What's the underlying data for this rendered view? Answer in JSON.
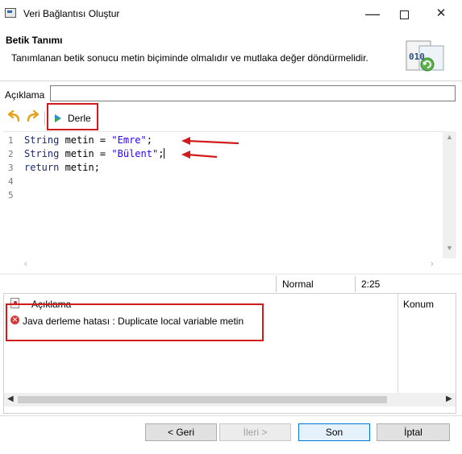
{
  "window": {
    "title": "Veri Bağlantısı Oluştur",
    "minimize_glyph": "—",
    "close_glyph": "✕"
  },
  "header": {
    "title": "Betik Tanımı",
    "description": "Tanımlanan betik sonucu metin biçiminde olmalıdır ve mutlaka değer döndürmelidir.",
    "icon_text": "010"
  },
  "form": {
    "description_label": "Açıklama",
    "description_value": ""
  },
  "toolbar": {
    "undo_icon": "undo-icon",
    "redo_icon": "redo-icon",
    "compile_label": "Derle"
  },
  "editor": {
    "line_numbers": [
      "1",
      "2",
      "3",
      "4",
      "5"
    ],
    "lines": [
      {
        "kw": "String",
        "rest": " metin = ",
        "str": "\"Emre\"",
        "end": ";"
      },
      {
        "kw": "String",
        "rest": " metin = ",
        "str": "\"Bülent\"",
        "end": ";"
      },
      {
        "kw": "return",
        "rest": " metin;",
        "str": "",
        "end": ""
      }
    ]
  },
  "status": {
    "mode": "Normal",
    "position": "2:25"
  },
  "problems": {
    "col_description": "Açıklama",
    "col_location": "Konum",
    "error_text": "Java derleme hatası : Duplicate local variable metin"
  },
  "buttons": {
    "back": "< Geri",
    "next": "İleri >",
    "finish": "Son",
    "cancel": "İptal"
  },
  "colors": {
    "highlight": "#d11a1a",
    "keyword": "#1d2a6f",
    "string": "#2a00ff",
    "primary_border": "#0078d7"
  }
}
